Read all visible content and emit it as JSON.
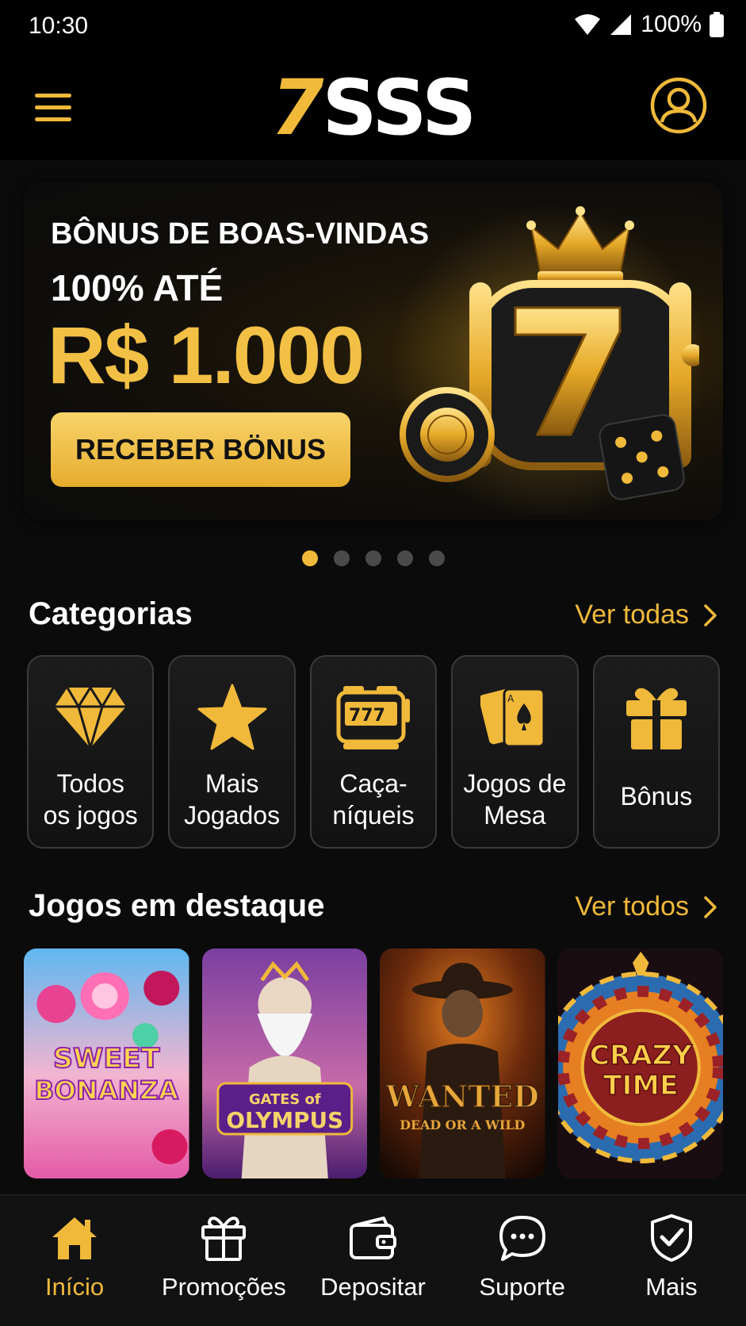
{
  "status_bar": {
    "time": "10:30",
    "battery": "100%"
  },
  "header": {
    "logo_seven": "7",
    "logo_rest": "SSS"
  },
  "banner": {
    "line1": "BÔNUS DE BOAS-VINDAS",
    "line2": "100% ATÉ",
    "amount": "R$ 1.000",
    "cta_label": "RECEBER BÖNUS"
  },
  "carousel": {
    "count": 5,
    "active_index": 0
  },
  "categories_section": {
    "title": "Categorias",
    "see_all": "Ver todas",
    "items": [
      {
        "label": "Todos\nos jogos",
        "icon": "diamond-icon"
      },
      {
        "label": "Mais\nJogados",
        "icon": "star-icon"
      },
      {
        "label": "Caça-\nníqueis",
        "icon": "slot-machine-icon"
      },
      {
        "label": "Jogos de\nMesa",
        "icon": "cards-icon"
      },
      {
        "label": "Bônus",
        "icon": "gift-icon"
      }
    ]
  },
  "featured_section": {
    "title": "Jogos em destaque",
    "see_all": "Ver todos",
    "games": [
      {
        "title_line1": "SWEET",
        "title_line2": "BONANZA"
      },
      {
        "title_line1": "GATES of",
        "title_line2": "OLYMPUS"
      },
      {
        "title_line1": "WANTED",
        "title_line2": "DEAD OR A WILD"
      },
      {
        "title_line1": "CRAZY",
        "title_line2": "TIME"
      }
    ]
  },
  "bottom_nav": [
    {
      "label": "Início",
      "icon": "home-icon",
      "active": true
    },
    {
      "label": "Promoções",
      "icon": "gift-icon",
      "active": false
    },
    {
      "label": "Depositar",
      "icon": "wallet-icon",
      "active": false
    },
    {
      "label": "Suporte",
      "icon": "chat-icon",
      "active": false
    },
    {
      "label": "Mais",
      "icon": "shield-icon",
      "active": false
    }
  ],
  "colors": {
    "accent": "#f0b93a",
    "background": "#0b0b0b",
    "card": "#1a1a1a"
  }
}
